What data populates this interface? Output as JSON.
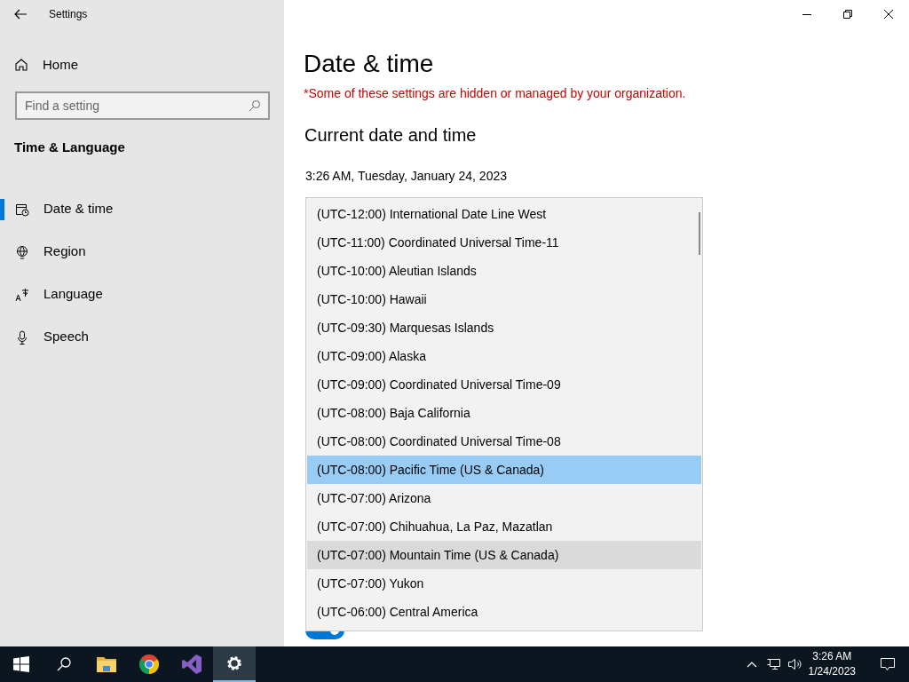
{
  "window": {
    "title": "Settings"
  },
  "sidebar": {
    "home": "Home",
    "search": {
      "placeholder": "Find a setting"
    },
    "section": "Time & Language",
    "items": [
      {
        "label": "Date & time",
        "selected": true
      },
      {
        "label": "Region",
        "selected": false
      },
      {
        "label": "Language",
        "selected": false
      },
      {
        "label": "Speech",
        "selected": false
      }
    ]
  },
  "main": {
    "title": "Date & time",
    "notice": "*Some of these settings are hidden or managed by your organization.",
    "heading": "Current date and time",
    "current": "3:26 AM, Tuesday, January 24, 2023",
    "timezones": [
      {
        "label": "(UTC-12:00) International Date Line West",
        "selected": false,
        "hovered": false
      },
      {
        "label": "(UTC-11:00) Coordinated Universal Time-11",
        "selected": false,
        "hovered": false
      },
      {
        "label": "(UTC-10:00) Aleutian Islands",
        "selected": false,
        "hovered": false
      },
      {
        "label": "(UTC-10:00) Hawaii",
        "selected": false,
        "hovered": false
      },
      {
        "label": "(UTC-09:30) Marquesas Islands",
        "selected": false,
        "hovered": false
      },
      {
        "label": "(UTC-09:00) Alaska",
        "selected": false,
        "hovered": false
      },
      {
        "label": "(UTC-09:00) Coordinated Universal Time-09",
        "selected": false,
        "hovered": false
      },
      {
        "label": "(UTC-08:00) Baja California",
        "selected": false,
        "hovered": false
      },
      {
        "label": "(UTC-08:00) Coordinated Universal Time-08",
        "selected": false,
        "hovered": false
      },
      {
        "label": "(UTC-08:00) Pacific Time (US & Canada)",
        "selected": true,
        "hovered": false
      },
      {
        "label": "(UTC-07:00) Arizona",
        "selected": false,
        "hovered": false
      },
      {
        "label": "(UTC-07:00) Chihuahua, La Paz, Mazatlan",
        "selected": false,
        "hovered": false
      },
      {
        "label": "(UTC-07:00) Mountain Time (US & Canada)",
        "selected": false,
        "hovered": true
      },
      {
        "label": "(UTC-07:00) Yukon",
        "selected": false,
        "hovered": false
      },
      {
        "label": "(UTC-06:00) Central America",
        "selected": false,
        "hovered": false
      }
    ],
    "toggle": {
      "on": true
    }
  },
  "taskbar": {
    "apps": [
      {
        "selected": false
      },
      {
        "selected": false
      },
      {
        "selected": false
      },
      {
        "selected": false
      },
      {
        "selected": true
      }
    ],
    "time": "3:26 AM",
    "date": "1/24/2023"
  }
}
